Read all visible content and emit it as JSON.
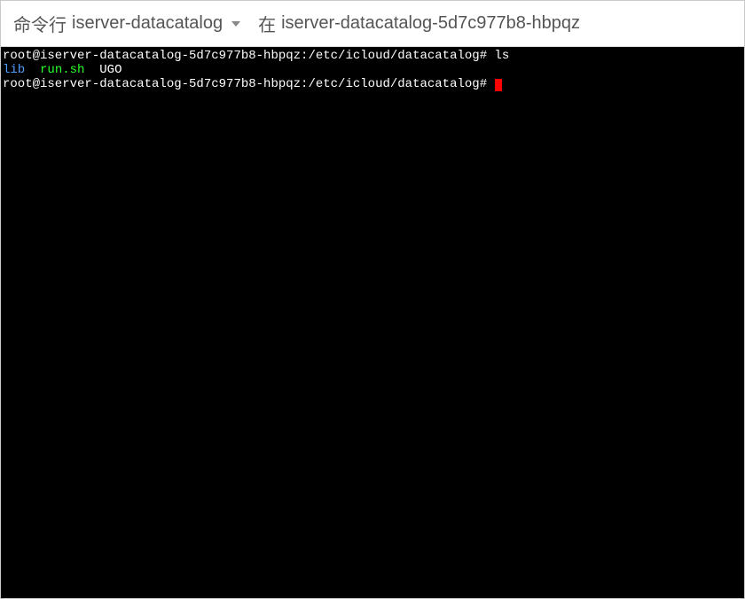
{
  "header": {
    "title": "命令行",
    "service_name": "iserver-datacatalog",
    "in_label": "在",
    "pod_name": "iserver-datacatalog-5d7c977b8-hbpqz"
  },
  "terminal": {
    "prompt1": "root@iserver-datacatalog-5d7c977b8-hbpqz:/etc/icloud/datacatalog#",
    "cmd1": "ls",
    "ls_output": {
      "item1": "lib",
      "item2": "run.sh",
      "item3": "UGO"
    },
    "prompt2": "root@iserver-datacatalog-5d7c977b8-hbpqz:/etc/icloud/datacatalog#"
  }
}
